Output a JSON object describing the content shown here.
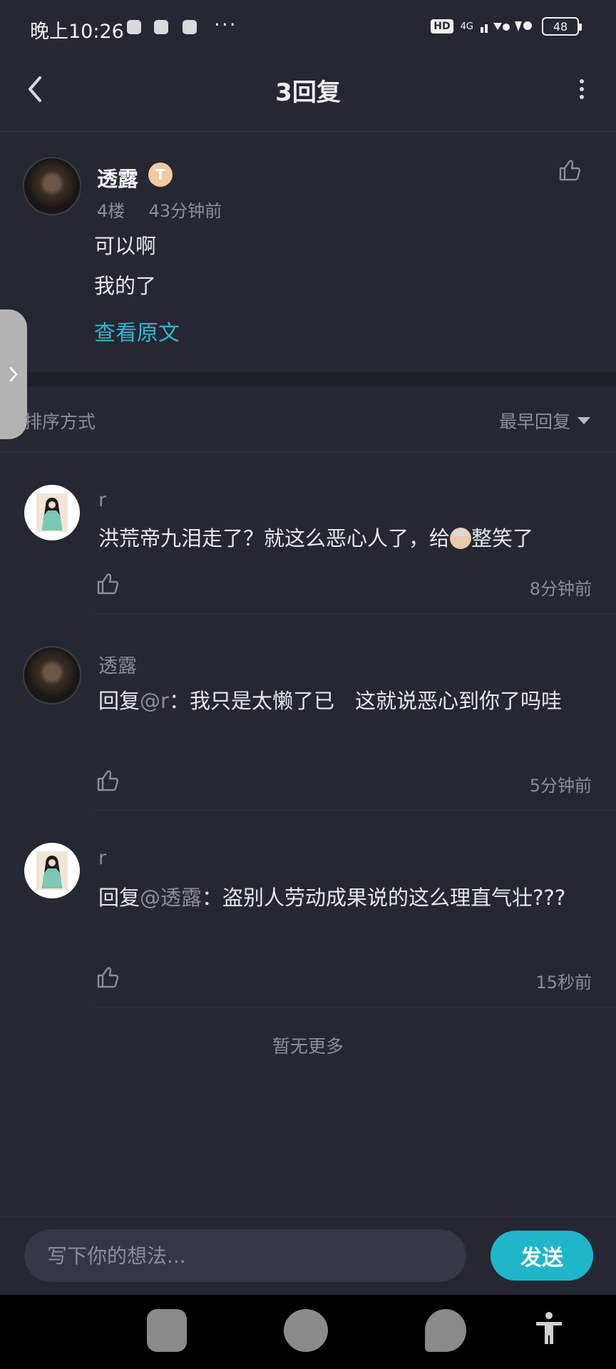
{
  "status_bar": {
    "time": "晚上10:26",
    "more": "···",
    "hd": "HD",
    "network": "4G",
    "battery": "48"
  },
  "header": {
    "title": "3回复",
    "back_icon": "chevron-left-icon",
    "menu_icon": "more-vertical-icon"
  },
  "original_post": {
    "author": "透露",
    "badge": "T",
    "floor": "4楼",
    "time": "43分钟前",
    "lines": [
      "可以啊",
      "我的了"
    ],
    "view_original": "查看原文"
  },
  "sort": {
    "label": "排序方式",
    "value": "最早回复"
  },
  "replies": [
    {
      "author": "r",
      "mention": "",
      "text_a": "洪荒帝九泪走了？就这么恶心人了，给",
      "text_b": "整笑了",
      "time": "8分钟前"
    },
    {
      "author": "透露",
      "prefix": "回复",
      "mention": "@r",
      "text": "：我只是太懒了已　这就说恶心到你了吗哇",
      "time": "5分钟前"
    },
    {
      "author": "r",
      "prefix": "回复",
      "mention": "@透露",
      "text": "：盗别人劳动成果说的这么理直气壮???",
      "time": "15秒前"
    }
  ],
  "no_more": "暂无更多",
  "composer": {
    "placeholder": "写下你的想法...",
    "send": "发送"
  },
  "colors": {
    "background": "#252733",
    "accent": "#1fb6c9",
    "link": "#2ab8cf",
    "muted": "#8b8d99"
  }
}
